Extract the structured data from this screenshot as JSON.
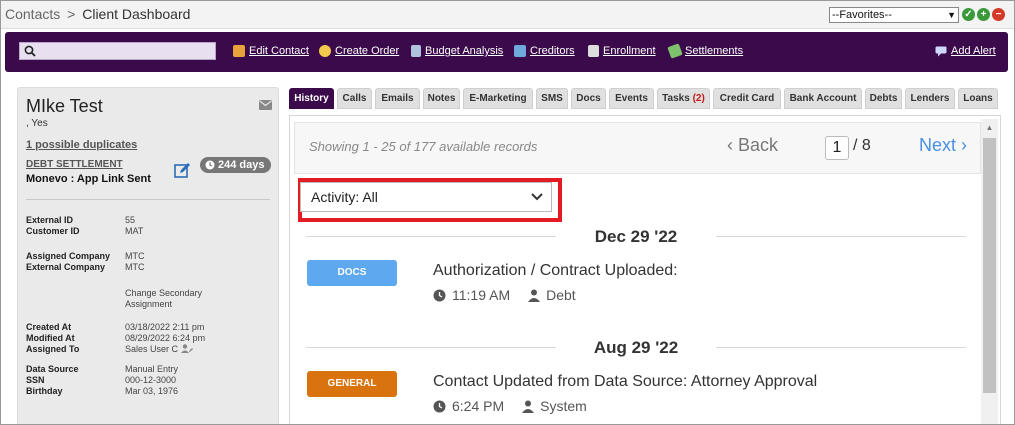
{
  "breadcrumb": {
    "parent": "Contacts",
    "separator": ">",
    "current": "Client Dashboard"
  },
  "favorites": {
    "selected": "--Favorites--"
  },
  "toolbar": {
    "search_placeholder": "",
    "items": [
      {
        "label": "Edit Contact",
        "icon": "edit-contact-icon",
        "color": "#e8a33a"
      },
      {
        "label": "Create Order",
        "icon": "create-order-icon",
        "color": "#f2c94c"
      },
      {
        "label": "Budget Analysis",
        "icon": "calculator-icon",
        "color": "#b0c4de"
      },
      {
        "label": "Creditors",
        "icon": "creditors-icon",
        "color": "#6fa8dc"
      },
      {
        "label": "Enrollment",
        "icon": "enrollment-icon",
        "color": "#dddddd"
      },
      {
        "label": "Settlements",
        "icon": "money-icon",
        "color": "#7cc36b"
      }
    ],
    "alert_label": "Add Alert"
  },
  "contact": {
    "name": "MIke Test",
    "subtitle": ", Yes",
    "duplicates_link": "1 possible duplicates",
    "program": "DEBT SETTLEMENT",
    "status": "Monevo : App Link Sent",
    "days_badge": "244 days",
    "fields": [
      {
        "label": "External ID",
        "value": "55"
      },
      {
        "label": "Customer ID",
        "value": "MAT"
      },
      {
        "label": "Assigned Company",
        "value": "MTC"
      },
      {
        "label": "External Company",
        "value": "MTC"
      },
      {
        "label": "",
        "value": "Change Secondary"
      },
      {
        "label": "",
        "value": "Assignment"
      },
      {
        "label": "Created At",
        "value": "03/18/2022 2:11 pm"
      },
      {
        "label": "Modified At",
        "value": "08/29/2022 6:24 pm"
      },
      {
        "label": "Assigned To",
        "value": "Sales User C"
      },
      {
        "label": "Data Source",
        "value": "Manual Entry"
      },
      {
        "label": "SSN",
        "value": "000-12-3000"
      },
      {
        "label": "Birthday",
        "value": "Mar 03, 1976"
      }
    ]
  },
  "tabs": [
    {
      "label": "History",
      "active": true
    },
    {
      "label": "Calls"
    },
    {
      "label": "Emails"
    },
    {
      "label": "Notes"
    },
    {
      "label": "E-Marketing"
    },
    {
      "label": "SMS"
    },
    {
      "label": "Docs"
    },
    {
      "label": "Events"
    },
    {
      "label": "Tasks",
      "count": "(2)"
    },
    {
      "label": "Credit Card"
    },
    {
      "label": "Bank Account"
    },
    {
      "label": "Debts"
    },
    {
      "label": "Lenders"
    },
    {
      "label": "Loans"
    }
  ],
  "history": {
    "showing_text": "Showing 1 - 25 of 177 available records",
    "back_label": "Back",
    "next_label": "Next",
    "page_current": "1",
    "page_total": "/ 8",
    "filter_value": "Activity: All",
    "groups": [
      {
        "date": "Dec 29 '22",
        "event": {
          "badge": "DOCS",
          "badge_color": "#5ea8ef",
          "title": "Authorization / Contract Uploaded:",
          "time": "11:19 AM",
          "user": "Debt"
        }
      },
      {
        "date": "Aug 29 '22",
        "event": {
          "badge": "GENERAL",
          "badge_color": "#d9730d",
          "title": "Contact Updated from Data Source: Attorney Approval",
          "time": "6:24 PM",
          "user": "System"
        }
      }
    ]
  }
}
